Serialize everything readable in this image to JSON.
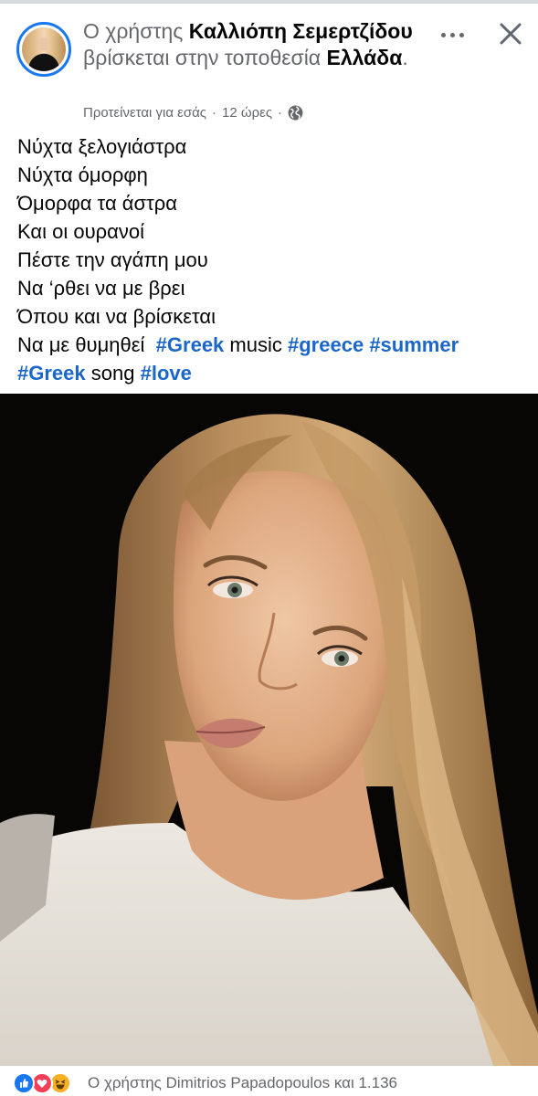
{
  "post": {
    "header": {
      "prefix": "Ο χρήστης",
      "author": "Καλλιόπη Σεμερτζίδου",
      "middle": "βρίσκεται στην τοποθεσία",
      "location": "Ελλάδα",
      "suffix": "."
    },
    "meta": {
      "suggested": "Προτείνεται για εσάς",
      "separator": "·",
      "time": "12 ώρες",
      "audience_icon": "globe-icon"
    },
    "actions": {
      "more_icon": "more-icon",
      "close_icon": "close-icon"
    },
    "text": {
      "lines": [
        "Νύχτα ξελογιάστρα",
        "Νύχτα όμορφη",
        "Όμορφα τα άστρα",
        "Και οι ουρανοί",
        "Πέστε την αγάπη μου",
        "Να ‘ρθει να με βρει",
        "Όπου και να βρίσκεται"
      ],
      "line8_plain": "Να με θυμηθεί",
      "tag_greek_1": "#Greek",
      "word_music": "music",
      "tag_greece": "#greece",
      "tag_summer": "#summer",
      "tag_greek_2": "#Greek",
      "word_song": "song",
      "tag_love": "#love"
    },
    "photo": {
      "description_icon": "portrait-photo"
    },
    "footer": {
      "reaction_icons": [
        "like-icon",
        "love-icon",
        "haha-icon"
      ],
      "text": "Ο χρήστης Dimitrios Papadopoulos και 1.136"
    }
  },
  "colors": {
    "facebook_blue": "#1877f2",
    "hashtag": "#1b66c9",
    "secondary_text": "#65676b",
    "love_red": "#f33e58",
    "haha_yellow": "#f7b125"
  }
}
